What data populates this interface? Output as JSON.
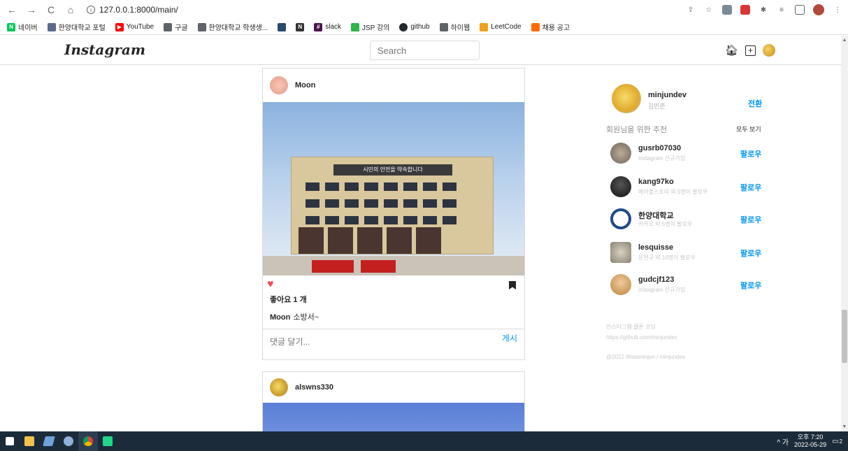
{
  "browser": {
    "url": "127.0.0.1:8000/main/",
    "bookmarks": [
      "네이버",
      "한양대학교 포털",
      "YouTube",
      "구글",
      "한양대학교 학생생...",
      "slack",
      "JSP 강의",
      "github",
      "하이웹",
      "LeetCode",
      "채용 공고"
    ]
  },
  "header": {
    "logo": "Instagram",
    "search_placeholder": "Search"
  },
  "feed": {
    "post1": {
      "username": "Moon",
      "banner_text": "시민의 안전을 약속합니다",
      "likes": "좋아요 1 개",
      "caption_user": "Moon",
      "caption_text": "소방서~",
      "comment_placeholder": "댓글 달기...",
      "post_button": "게시"
    },
    "post2": {
      "username": "alswns330"
    }
  },
  "sidebar": {
    "me": {
      "username": "minjundev",
      "name": "김민준",
      "switch_label": "전환"
    },
    "recommend_title": "회원님을 위한 추천",
    "see_all": "모두 보기",
    "recommendations": [
      {
        "username": "gusrb07030",
        "sub": "Instagram 신규가입",
        "follow": "팔로우"
      },
      {
        "username": "kang97ko",
        "sub": "메이플스토리 외 5명이 팔로우",
        "follow": "팔로우"
      },
      {
        "username": "한양대학교",
        "sub": "카카오 외 5명이 팔로우",
        "follow": "팔로우"
      },
      {
        "username": "lesquisse",
        "sub": "문현규 외 10명이 팔로우",
        "follow": "팔로우"
      },
      {
        "username": "gudcjf123",
        "sub": "Instagram 신규가입",
        "follow": "팔로우"
      }
    ],
    "footer_line1": "인스타그램 클론 코딩",
    "footer_line2": "https://github.com/minjundev",
    "footer_line3": "@2022 thisisminjun / minjundev"
  },
  "taskbar": {
    "tray_text": "^ 가",
    "time": "오후 7:20",
    "date": "2022-05-29",
    "notif_count": "2"
  },
  "colors": {
    "accent": "#0095f6",
    "like": "#ed4956",
    "border": "#dbdbdb"
  }
}
